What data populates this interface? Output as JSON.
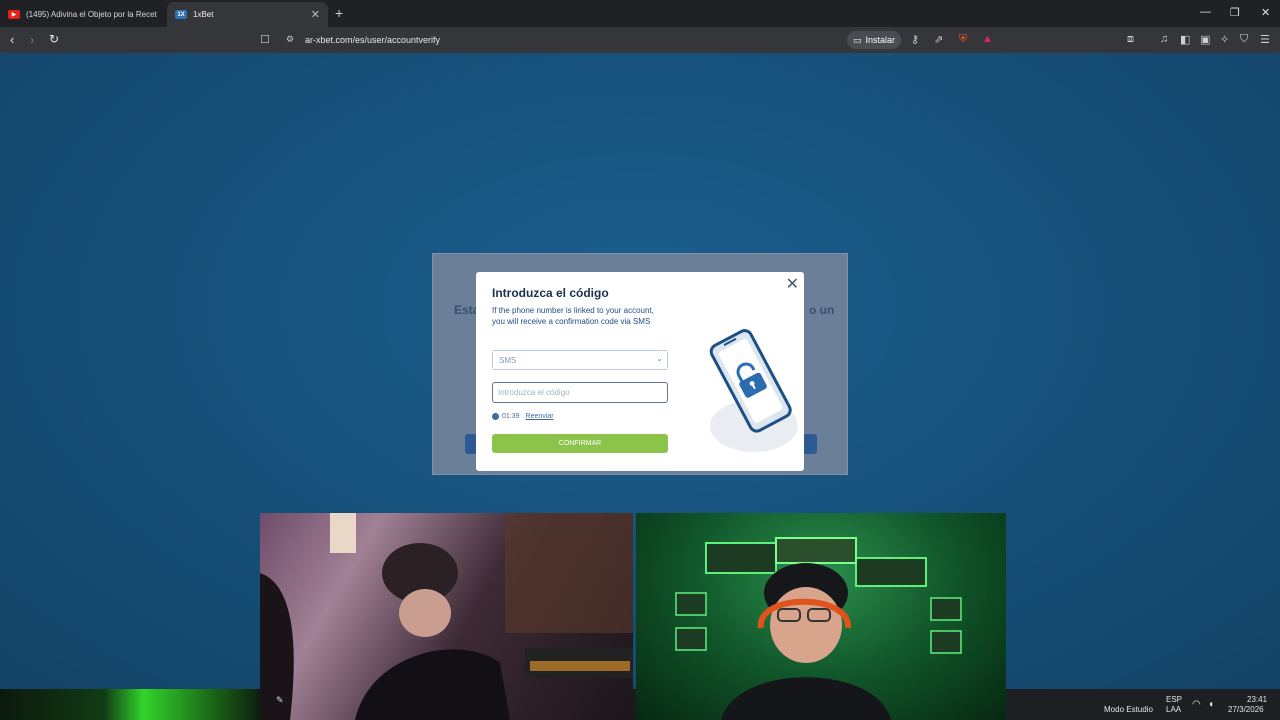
{
  "browser": {
    "tabs": [
      {
        "title": "(1495) Adivina el Objeto por la Recet",
        "favicon": "youtube-icon",
        "active": false
      },
      {
        "title": "1xBet",
        "favicon": "1xbet-icon",
        "active": true
      }
    ],
    "url": "ar-xbet.com/es/user/accountverify",
    "install_label": "Instalar"
  },
  "background_form": {
    "title_left": "Esta",
    "title_right": "o un"
  },
  "modal": {
    "title": "Introduzca el código",
    "description": "If the phone number is linked to your account, you will receive a confirmation code via SMS",
    "method_selected": "SMS",
    "code_placeholder": "Introduzca el código",
    "timer": "01:39",
    "resend_label": "Reenviar",
    "confirm_label": "CONFIRMAR"
  },
  "taskbar": {
    "language_top": "ESP",
    "language_bottom": "LAA",
    "time": "23:41",
    "date": "27/3/2026",
    "mode_label": "Modo Estudio"
  },
  "colors": {
    "page_bg": "#17527c",
    "confirm_green": "#8cc34a",
    "title_navy": "#1a3150"
  }
}
